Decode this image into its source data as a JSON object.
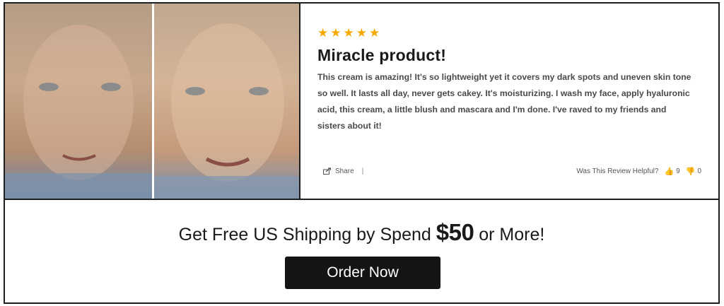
{
  "review": {
    "rating": 5,
    "stars": [
      "★",
      "★",
      "★",
      "★",
      "★"
    ],
    "title": "Miracle product!",
    "body": "This cream is amazing! It's so lightweight yet it covers my dark spots and uneven skin tone so well. It lasts all day, never gets cakey. It's moisturizing. I wash my face, apply hyaluronic acid, this cream, a little blush and mascara and I'm done. I've raved to my friends and sisters about it!",
    "share_label": "Share",
    "separator": "|",
    "helpful_label": "Was This Review Helpful?",
    "helpful_yes_count": "9",
    "helpful_no_count": "0"
  },
  "photos": {
    "before_icon": "before-photo",
    "after_icon": "after-photo"
  },
  "promo": {
    "text_before": "Get Free US Shipping by Spend ",
    "price": "$50",
    "text_after": " or More!",
    "button_label": "Order Now"
  },
  "colors": {
    "star": "#f5a900",
    "button_bg": "#141414",
    "border": "#1e1e1e"
  }
}
